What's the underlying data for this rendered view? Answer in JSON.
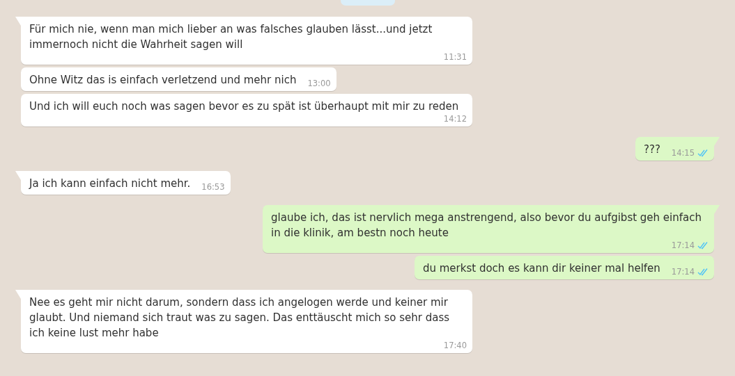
{
  "messages": [
    {
      "kind": "incoming",
      "tail": true,
      "text": "Für mich nie, wenn man mich lieber an was falsches glauben lässt...und jetzt immernoch nicht die Wahrheit sagen will",
      "time": "11:31"
    },
    {
      "kind": "incoming",
      "tail": false,
      "text": "Ohne Witz das is einfach verletzend und mehr nich",
      "time": "13:00"
    },
    {
      "kind": "incoming",
      "tail": false,
      "text": "Und ich will euch noch was sagen bevor es zu spät ist überhaupt mit mir zu reden",
      "time": "14:12"
    },
    {
      "kind": "outgoing",
      "tail": true,
      "text": "???",
      "time": "14:15",
      "read": true
    },
    {
      "kind": "incoming",
      "tail": true,
      "text": "Ja ich kann einfach nicht mehr.",
      "time": "16:53"
    },
    {
      "kind": "outgoing",
      "tail": true,
      "text": "glaube ich, das ist nervlich mega anstrengend, also bevor du aufgibst geh einfach in die klinik, am bestn noch heute",
      "time": "17:14",
      "read": true
    },
    {
      "kind": "outgoing",
      "tail": false,
      "text": "du merkst doch es kann dir keiner mal helfen",
      "time": "17:14",
      "read": true
    },
    {
      "kind": "incoming",
      "tail": true,
      "text": "Nee es geht mir nicht darum, sondern dass ich angelogen werde und keiner mir glaubt. Und niemand sich traut was zu sagen. Das enttäuscht mich so sehr dass ich keine lust mehr habe",
      "time": "17:40"
    }
  ]
}
